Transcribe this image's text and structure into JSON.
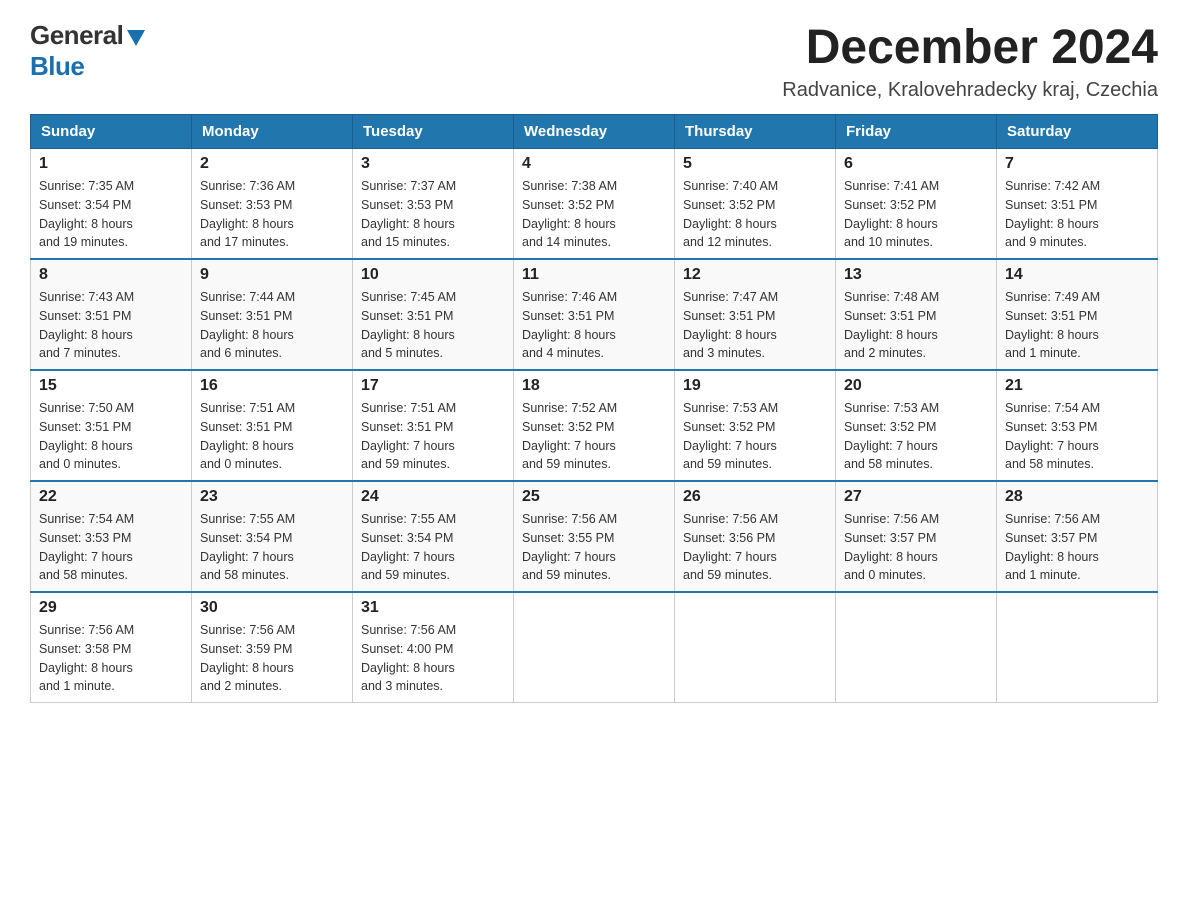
{
  "logo": {
    "general": "General",
    "blue": "Blue"
  },
  "header": {
    "month": "December 2024",
    "location": "Radvanice, Kralovehradecky kraj, Czechia"
  },
  "days_of_week": [
    "Sunday",
    "Monday",
    "Tuesday",
    "Wednesday",
    "Thursday",
    "Friday",
    "Saturday"
  ],
  "weeks": [
    [
      {
        "day": "1",
        "sunrise": "7:35 AM",
        "sunset": "3:54 PM",
        "daylight": "8 hours and 19 minutes."
      },
      {
        "day": "2",
        "sunrise": "7:36 AM",
        "sunset": "3:53 PM",
        "daylight": "8 hours and 17 minutes."
      },
      {
        "day": "3",
        "sunrise": "7:37 AM",
        "sunset": "3:53 PM",
        "daylight": "8 hours and 15 minutes."
      },
      {
        "day": "4",
        "sunrise": "7:38 AM",
        "sunset": "3:52 PM",
        "daylight": "8 hours and 14 minutes."
      },
      {
        "day": "5",
        "sunrise": "7:40 AM",
        "sunset": "3:52 PM",
        "daylight": "8 hours and 12 minutes."
      },
      {
        "day": "6",
        "sunrise": "7:41 AM",
        "sunset": "3:52 PM",
        "daylight": "8 hours and 10 minutes."
      },
      {
        "day": "7",
        "sunrise": "7:42 AM",
        "sunset": "3:51 PM",
        "daylight": "8 hours and 9 minutes."
      }
    ],
    [
      {
        "day": "8",
        "sunrise": "7:43 AM",
        "sunset": "3:51 PM",
        "daylight": "8 hours and 7 minutes."
      },
      {
        "day": "9",
        "sunrise": "7:44 AM",
        "sunset": "3:51 PM",
        "daylight": "8 hours and 6 minutes."
      },
      {
        "day": "10",
        "sunrise": "7:45 AM",
        "sunset": "3:51 PM",
        "daylight": "8 hours and 5 minutes."
      },
      {
        "day": "11",
        "sunrise": "7:46 AM",
        "sunset": "3:51 PM",
        "daylight": "8 hours and 4 minutes."
      },
      {
        "day": "12",
        "sunrise": "7:47 AM",
        "sunset": "3:51 PM",
        "daylight": "8 hours and 3 minutes."
      },
      {
        "day": "13",
        "sunrise": "7:48 AM",
        "sunset": "3:51 PM",
        "daylight": "8 hours and 2 minutes."
      },
      {
        "day": "14",
        "sunrise": "7:49 AM",
        "sunset": "3:51 PM",
        "daylight": "8 hours and 1 minute."
      }
    ],
    [
      {
        "day": "15",
        "sunrise": "7:50 AM",
        "sunset": "3:51 PM",
        "daylight": "8 hours and 0 minutes."
      },
      {
        "day": "16",
        "sunrise": "7:51 AM",
        "sunset": "3:51 PM",
        "daylight": "8 hours and 0 minutes."
      },
      {
        "day": "17",
        "sunrise": "7:51 AM",
        "sunset": "3:51 PM",
        "daylight": "7 hours and 59 minutes."
      },
      {
        "day": "18",
        "sunrise": "7:52 AM",
        "sunset": "3:52 PM",
        "daylight": "7 hours and 59 minutes."
      },
      {
        "day": "19",
        "sunrise": "7:53 AM",
        "sunset": "3:52 PM",
        "daylight": "7 hours and 59 minutes."
      },
      {
        "day": "20",
        "sunrise": "7:53 AM",
        "sunset": "3:52 PM",
        "daylight": "7 hours and 58 minutes."
      },
      {
        "day": "21",
        "sunrise": "7:54 AM",
        "sunset": "3:53 PM",
        "daylight": "7 hours and 58 minutes."
      }
    ],
    [
      {
        "day": "22",
        "sunrise": "7:54 AM",
        "sunset": "3:53 PM",
        "daylight": "7 hours and 58 minutes."
      },
      {
        "day": "23",
        "sunrise": "7:55 AM",
        "sunset": "3:54 PM",
        "daylight": "7 hours and 58 minutes."
      },
      {
        "day": "24",
        "sunrise": "7:55 AM",
        "sunset": "3:54 PM",
        "daylight": "7 hours and 59 minutes."
      },
      {
        "day": "25",
        "sunrise": "7:56 AM",
        "sunset": "3:55 PM",
        "daylight": "7 hours and 59 minutes."
      },
      {
        "day": "26",
        "sunrise": "7:56 AM",
        "sunset": "3:56 PM",
        "daylight": "7 hours and 59 minutes."
      },
      {
        "day": "27",
        "sunrise": "7:56 AM",
        "sunset": "3:57 PM",
        "daylight": "8 hours and 0 minutes."
      },
      {
        "day": "28",
        "sunrise": "7:56 AM",
        "sunset": "3:57 PM",
        "daylight": "8 hours and 1 minute."
      }
    ],
    [
      {
        "day": "29",
        "sunrise": "7:56 AM",
        "sunset": "3:58 PM",
        "daylight": "8 hours and 1 minute."
      },
      {
        "day": "30",
        "sunrise": "7:56 AM",
        "sunset": "3:59 PM",
        "daylight": "8 hours and 2 minutes."
      },
      {
        "day": "31",
        "sunrise": "7:56 AM",
        "sunset": "4:00 PM",
        "daylight": "8 hours and 3 minutes."
      },
      null,
      null,
      null,
      null
    ]
  ],
  "labels": {
    "sunrise": "Sunrise:",
    "sunset": "Sunset:",
    "daylight": "Daylight:"
  }
}
